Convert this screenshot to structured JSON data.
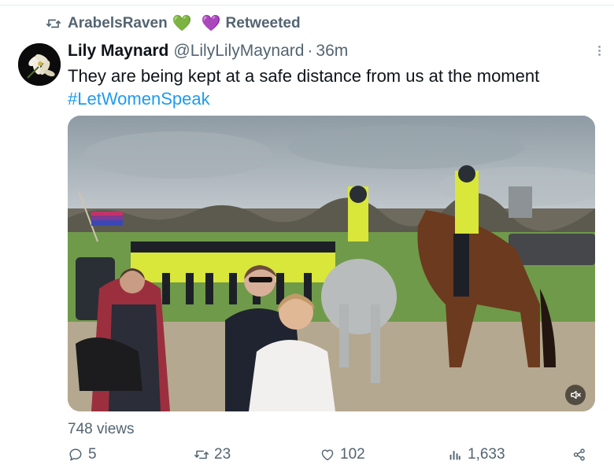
{
  "retweet": {
    "user": "ArabelsRaven",
    "hearts": [
      "💚",
      "💜"
    ],
    "label": "Retweeted",
    "icon": "retweet-icon"
  },
  "tweet": {
    "author_name": "Lily Maynard",
    "author_handle": "@LilyLilyMaynard",
    "separator": "·",
    "time": "36m",
    "text": "They are being kept at a safe distance from us at the moment",
    "hashtag": "#LetWomenSpeak",
    "avatar_icon": "lily-flower-avatar",
    "more_icon": "more-options-icon"
  },
  "media": {
    "type": "video",
    "mute_icon": "speaker-muted-icon"
  },
  "stats": {
    "views": "748 views"
  },
  "actions": {
    "reply": {
      "icon": "reply-icon",
      "count": "5"
    },
    "retweet": {
      "icon": "retweet-icon",
      "count": "23"
    },
    "like": {
      "icon": "heart-icon",
      "count": "102"
    },
    "views": {
      "icon": "analytics-icon",
      "count": "1,633"
    },
    "share": {
      "icon": "share-icon"
    }
  },
  "colors": {
    "text_primary": "#0f1419",
    "text_secondary": "#536471",
    "link": "#1d9bf0"
  }
}
